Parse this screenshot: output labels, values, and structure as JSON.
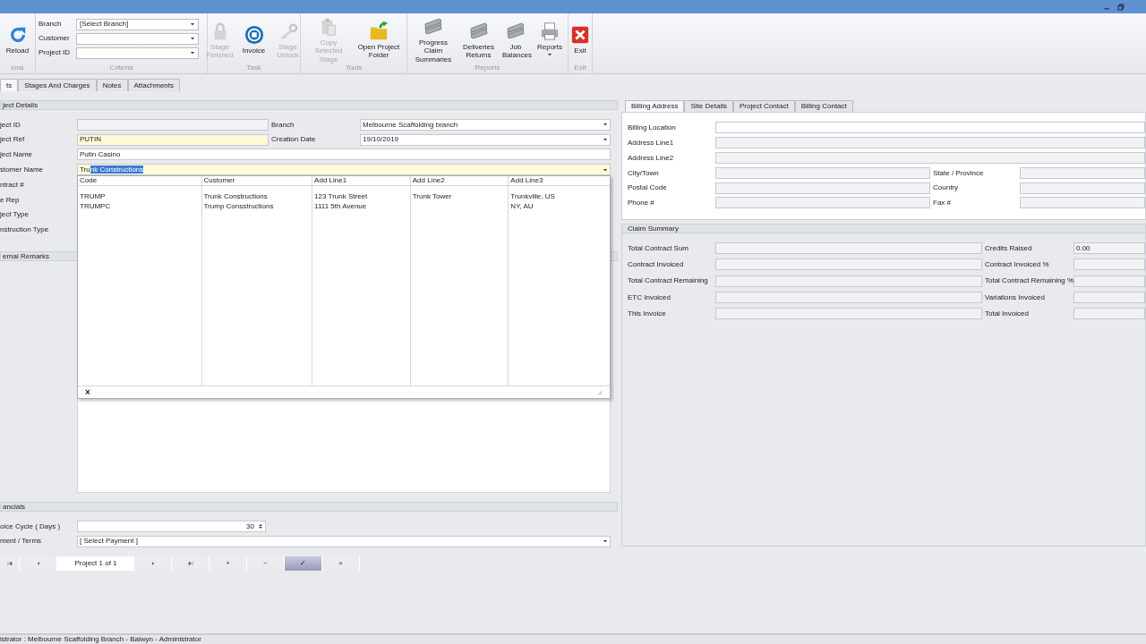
{
  "ribbon": {
    "groups": [
      {
        "label": "ions",
        "items": [
          {
            "kind": "button",
            "label": "Reload",
            "disabled": false
          }
        ]
      },
      {
        "label": "Criteria",
        "items": [
          {
            "kind": "combo",
            "label": "Branch",
            "value": "[Select Branch]"
          },
          {
            "kind": "combo",
            "label": "Customer"
          },
          {
            "kind": "combo",
            "label": "Project ID"
          }
        ]
      },
      {
        "label": "Task",
        "items": [
          {
            "kind": "button",
            "label": "Stage Finished",
            "disabled": true
          },
          {
            "kind": "button",
            "label": "Invoice",
            "disabled": false
          },
          {
            "kind": "button",
            "label": "Stage Unlock",
            "disabled": true
          }
        ]
      },
      {
        "label": "Tools",
        "items": [
          {
            "kind": "button",
            "label": "Copy Selected Stage",
            "disabled": true
          },
          {
            "kind": "button",
            "label": "Open Project Folder",
            "disabled": false
          }
        ]
      },
      {
        "label": "Reports",
        "items": [
          {
            "kind": "button",
            "label": "Progress Claim Summaries",
            "disabled": false
          },
          {
            "kind": "button",
            "label": "Deliveries Returns",
            "disabled": false
          },
          {
            "kind": "button",
            "label": "Job Balances",
            "disabled": false
          },
          {
            "kind": "menu-button",
            "label": "Reports",
            "disabled": false
          }
        ]
      },
      {
        "label": "Exit",
        "items": [
          {
            "kind": "button",
            "label": "Exit",
            "disabled": false
          }
        ]
      }
    ]
  },
  "tabs": [
    {
      "label": "ts",
      "selected": true
    },
    {
      "label": "Stages And Charges",
      "selected": false
    },
    {
      "label": "Notes",
      "selected": false
    },
    {
      "label": "Attachments",
      "selected": false
    }
  ],
  "project_details": {
    "title": "ject Details",
    "rows": [
      {
        "cells": [
          {
            "label": "ject ID",
            "field": {
              "kind": "text",
              "readonly": true
            }
          },
          {
            "label": "Branch",
            "field": {
              "kind": "combo",
              "value": "Melbourne Scaffolding branch"
            }
          }
        ]
      },
      {
        "cells": [
          {
            "label": "ject Ref",
            "field": {
              "kind": "text",
              "required": true,
              "value": "PUTIN"
            }
          },
          {
            "label": "Creation Date",
            "field": {
              "kind": "combo",
              "value": "19/10/2019"
            }
          }
        ]
      },
      {
        "cells": [
          {
            "label": "ject Name",
            "field": {
              "kind": "text",
              "value": "Putin Casino"
            }
          }
        ]
      },
      {
        "cells": [
          {
            "label": "stomer Name",
            "field": {
              "kind": "combo",
              "required": true,
              "value": "Tru",
              "selected_text": "nk Constructions"
            }
          }
        ]
      },
      {
        "cells": [
          {
            "label": "ntract #"
          }
        ]
      },
      {
        "cells": [
          {
            "label": "e Rep"
          }
        ]
      },
      {
        "cells": [
          {
            "label": "ject Type"
          }
        ]
      },
      {
        "cells": [
          {
            "label": "nstruction Type"
          }
        ]
      }
    ]
  },
  "remarks": {
    "title": "ernal Remarks"
  },
  "financials": {
    "title": "ancials",
    "rows": [
      {
        "cells": [
          {
            "label": "oice Cycle ( Days )",
            "field": {
              "kind": "spin",
              "value": "30"
            }
          }
        ]
      },
      {
        "cells": [
          {
            "label": "ment / Terms",
            "field": {
              "kind": "combo",
              "value": "[ Select Payment ]"
            }
          }
        ]
      }
    ]
  },
  "navigator": [
    {
      "kind": "first",
      "selected": false
    },
    {
      "kind": "prev",
      "selected": false
    },
    {
      "kind": "label",
      "text": "Project 1 of 1"
    },
    {
      "kind": "next",
      "selected": false
    },
    {
      "kind": "last",
      "selected": false
    },
    {
      "kind": "text",
      "text": "+",
      "selected": false
    },
    {
      "kind": "text",
      "text": "−",
      "selected": false
    },
    {
      "kind": "text",
      "text": "✓",
      "selected": true
    },
    {
      "kind": "text",
      "text": "×",
      "selected": false
    }
  ],
  "customer_dropdown": {
    "columns": [
      "Code",
      "Customer",
      "Add Line1",
      "Add Line2",
      "Add Line3"
    ],
    "rows": [
      [
        "TRUMP",
        "Trunk Constructions",
        "123 Trunk Street",
        "Trunk Tower",
        "Trunkville, US"
      ],
      [
        "TRUMPC",
        "Trump Consstructions",
        "1111 5th Avenue",
        "",
        "NY, AU"
      ]
    ],
    "close": "×"
  },
  "address_tabs": [
    {
      "label": "Billing Address",
      "selected": true
    },
    {
      "label": "Site Details",
      "selected": false
    },
    {
      "label": "Project Contact",
      "selected": false
    },
    {
      "label": "Billing Contact",
      "selected": false
    }
  ],
  "billing_address": {
    "rows": [
      {
        "cells": [
          {
            "label": "Billing Location",
            "field": {
              "kind": "text"
            }
          }
        ]
      },
      {
        "cells": [
          {
            "label": "Address Line1",
            "field": {
              "kind": "text",
              "readonly": true
            }
          }
        ]
      },
      {
        "cells": [
          {
            "label": "Address Line2",
            "field": {
              "kind": "text",
              "readonly": true
            }
          }
        ]
      },
      {
        "cells": [
          {
            "label": "City/Town",
            "field": {
              "kind": "text",
              "readonly": true
            }
          },
          {
            "label": "State / Province",
            "field": {
              "kind": "text",
              "readonly": true
            }
          }
        ]
      },
      {
        "cells": [
          {
            "label": "Postal Code",
            "field": {
              "kind": "text",
              "readonly": true
            }
          },
          {
            "label": "Country",
            "field": {
              "kind": "text",
              "readonly": true
            }
          }
        ]
      },
      {
        "cells": [
          {
            "label": "Phone #",
            "field": {
              "kind": "text",
              "readonly": true
            }
          },
          {
            "label": "Fax #",
            "field": {
              "kind": "text",
              "readonly": true
            }
          }
        ]
      }
    ]
  },
  "claim_summary": {
    "title": "Claim Summary",
    "rows": [
      {
        "cells": [
          {
            "label": "Total Contract Sum",
            "field": {
              "kind": "text",
              "readonly": true
            }
          },
          {
            "label": "Credits Raised",
            "field": {
              "kind": "text",
              "readonly": true,
              "value": "0.00"
            }
          }
        ]
      },
      {
        "cells": [
          {
            "label": "Contract Invoiced",
            "field": {
              "kind": "text",
              "readonly": true
            }
          },
          {
            "label": "Contract Invoiced %",
            "field": {
              "kind": "text",
              "readonly": true
            }
          }
        ]
      },
      {
        "cells": [
          {
            "label": "Total Contract Remaining",
            "field": {
              "kind": "text",
              "readonly": true
            }
          },
          {
            "label": "Total Contract Remaining %",
            "field": {
              "kind": "text",
              "readonly": true
            }
          }
        ]
      },
      {
        "cells": [
          {
            "label": "ETC Invoiced",
            "field": {
              "kind": "text",
              "readonly": true
            }
          },
          {
            "label": "Variations Invoiced",
            "field": {
              "kind": "text",
              "readonly": true
            }
          }
        ]
      },
      {
        "cells": [
          {
            "label": "This Invoice",
            "field": {
              "kind": "text",
              "readonly": true
            }
          },
          {
            "label": "Total Invoiced",
            "field": {
              "kind": "text",
              "readonly": true
            }
          }
        ]
      }
    ]
  },
  "status_bar": "istrator : Melbourne Scaffolding Branch - Balwyn - Administrator"
}
